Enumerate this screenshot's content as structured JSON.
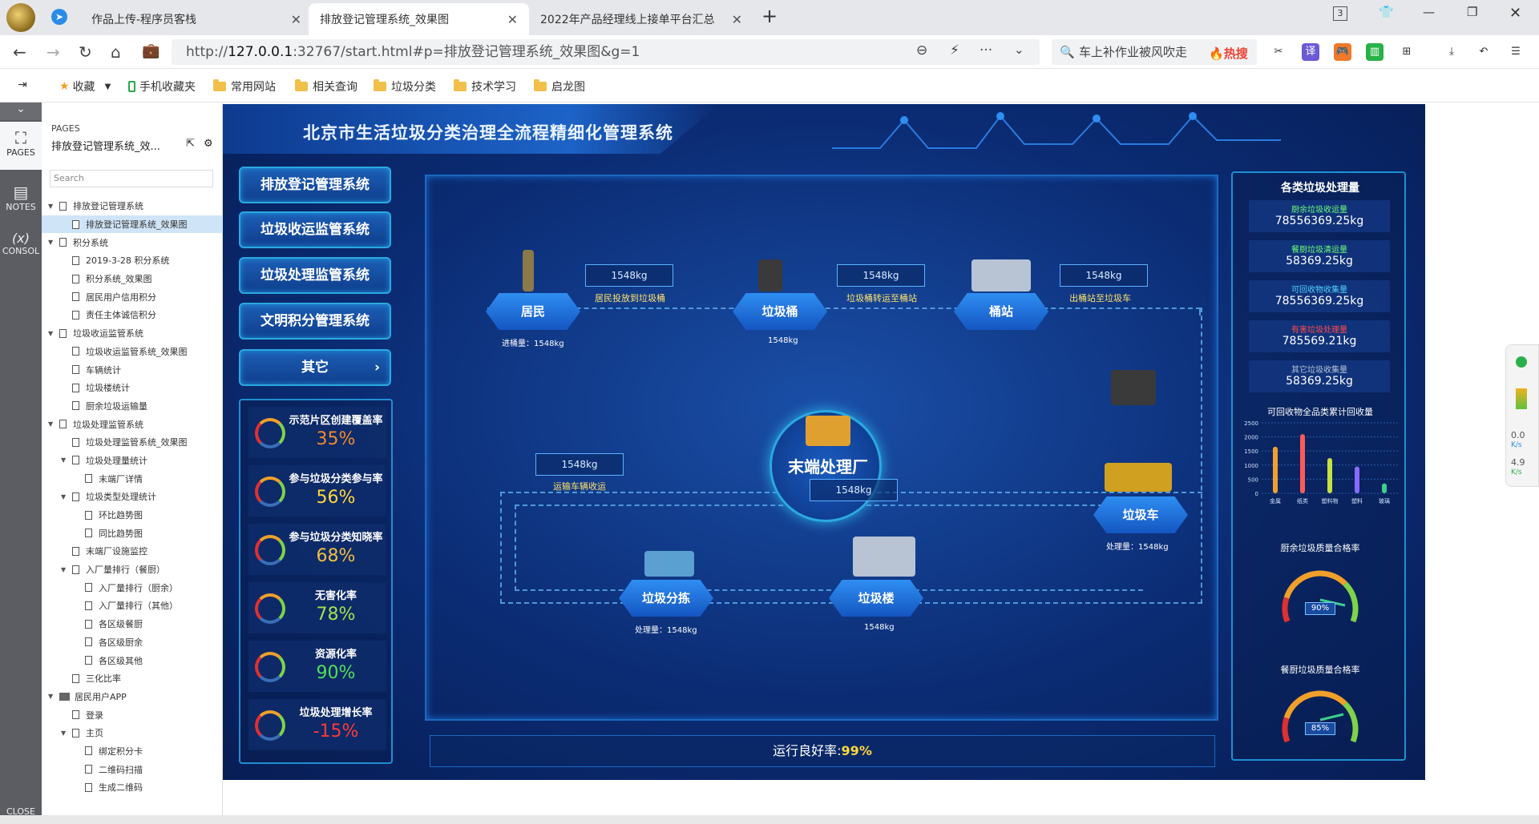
{
  "browser": {
    "tabs": [
      {
        "label": "作品上传-程序员客栈"
      },
      {
        "label": "排放登记管理系统_效果图"
      },
      {
        "label": "2022年产品经理线上接单平台汇总"
      }
    ],
    "tab_count": "3",
    "url_prefix": "http://",
    "url_host": "127.0.0.1",
    "url_rest": ":32767/start.html#p=排放登记管理系统_效果图&g=1",
    "search_text": "车上补作业被风吹走",
    "hot_label": "热搜"
  },
  "bookmarks": [
    "收藏",
    "手机收藏夹",
    "常用网站",
    "相关查询",
    "垃圾分类",
    "技术学习",
    "启龙图"
  ],
  "rail": {
    "pages": "PAGES",
    "notes": "NOTES",
    "console": "CONSOL",
    "close": "CLOSE"
  },
  "pages_panel": {
    "header": "PAGES",
    "current": "排放登记管理系统_效...",
    "search_placeholder": "Search",
    "tree": [
      {
        "label": "排放登记管理系统",
        "level": 0,
        "arrow": true
      },
      {
        "label": "排放登记管理系统_效果图",
        "level": 1,
        "selected": true
      },
      {
        "label": "积分系统",
        "level": 0,
        "arrow": true
      },
      {
        "label": "2019-3-28 积分系统",
        "level": 1
      },
      {
        "label": "积分系统_效果图",
        "level": 1
      },
      {
        "label": "居民用户信用积分",
        "level": 1
      },
      {
        "label": "责任主体诚信积分",
        "level": 1
      },
      {
        "label": "垃圾收运监管系统",
        "level": 0,
        "arrow": true
      },
      {
        "label": "垃圾收运监管系统_效果图",
        "level": 1
      },
      {
        "label": "车辆统计",
        "level": 1
      },
      {
        "label": "垃圾楼统计",
        "level": 1
      },
      {
        "label": "厨余垃圾运输量",
        "level": 1
      },
      {
        "label": "垃圾处理监管系统",
        "level": 0,
        "arrow": true
      },
      {
        "label": "垃圾处理监管系统_效果图",
        "level": 1
      },
      {
        "label": "垃圾处理量统计",
        "level": 1,
        "arrow": true
      },
      {
        "label": "末端厂详情",
        "level": 2
      },
      {
        "label": "垃圾类型处理统计",
        "level": 1,
        "arrow": true
      },
      {
        "label": "环比趋势图",
        "level": 2
      },
      {
        "label": "同比趋势图",
        "level": 2
      },
      {
        "label": "末端厂设施监控",
        "level": 1
      },
      {
        "label": "入厂量排行（餐厨）",
        "level": 1,
        "arrow": true
      },
      {
        "label": "入厂量排行（厨余）",
        "level": 2
      },
      {
        "label": "入厂量排行（其他）",
        "level": 2
      },
      {
        "label": "各区级餐厨",
        "level": 2
      },
      {
        "label": "各区级厨余",
        "level": 2
      },
      {
        "label": "各区级其他",
        "level": 2
      },
      {
        "label": "三化比率",
        "level": 1
      },
      {
        "label": "居民用户APP",
        "level": 0,
        "arrow": true,
        "folder": true
      },
      {
        "label": "登录",
        "level": 1
      },
      {
        "label": "主页",
        "level": 1,
        "arrow": true
      },
      {
        "label": "绑定积分卡",
        "level": 2
      },
      {
        "label": "二维码扫描",
        "level": 2
      },
      {
        "label": "生成二维码",
        "level": 2
      }
    ]
  },
  "dashboard": {
    "title": "北京市生活垃圾分类治理全流程精细化管理系统",
    "menu": [
      "排放登记管理系统",
      "垃圾收运监管系统",
      "垃圾处理监管系统",
      "文明积分管理系统",
      "其它"
    ],
    "metrics": [
      {
        "label": "示范片区创建覆盖率",
        "value": "35%",
        "color": "#f08a2a"
      },
      {
        "label": "参与垃圾分类参与率",
        "value": "56%",
        "color": "#ffd93b"
      },
      {
        "label": "参与垃圾分类知晓率",
        "value": "68%",
        "color": "#f0c040"
      },
      {
        "label": "无害化率",
        "value": "78%",
        "color": "#a6e04a"
      },
      {
        "label": "资源化率",
        "value": "90%",
        "color": "#4fe05a"
      },
      {
        "label": "垃圾处理增长率",
        "value": "-15%",
        "color": "#ff3a3a"
      }
    ],
    "flow": {
      "nodes": {
        "resident": "居民",
        "bin": "垃圾桶",
        "station": "桶站",
        "truck": "垃圾车",
        "sort": "垃圾分拣",
        "tower": "垃圾楼",
        "center": "末端处理厂"
      },
      "values": {
        "v1": "1548kg",
        "v2": "1548kg",
        "v3": "1548kg",
        "v4": "1548kg",
        "center": "1548kg"
      },
      "labels": {
        "l1": "居民投放到垃圾桶",
        "l2": "垃圾桶转运至桶站",
        "l3": "出桶站至垃圾车",
        "l4": "运输车辆收运"
      },
      "subs": {
        "resident": "进桶量：1548kg",
        "bin": "1548kg",
        "truck": "处理量：1548kg",
        "sort": "处理量：1548kg",
        "tower": "1548kg"
      }
    },
    "running": {
      "label": "运行良好率:",
      "value": "99%"
    },
    "right": {
      "title": "各类垃圾处理量",
      "stats": [
        {
          "label": "厨余垃圾收运量",
          "value": "78556369.25kg",
          "color": "#6bff7a"
        },
        {
          "label": "餐厨垃圾清运量",
          "value": "58369.25kg",
          "color": "#6bff7a"
        },
        {
          "label": "可回收物收集量",
          "value": "78556369.25kg",
          "color": "#4fd2ff"
        },
        {
          "label": "有害垃圾处理量",
          "value": "785569.21kg",
          "color": "#ff4a4a"
        },
        {
          "label": "其它垃圾收集量",
          "value": "58369.25kg",
          "color": "#b7c4d8"
        }
      ],
      "bar_title": "可回收物全品类累计回收量",
      "gauge1_title": "厨余垃圾质量合格率",
      "gauge1_value": "90%",
      "gauge2_title": "餐厨垃圾质量合格率",
      "gauge2_value": "85%"
    }
  },
  "chart_data": {
    "type": "bar",
    "title": "可回收物全品类累计回收量",
    "categories": [
      "金属",
      "纸类",
      "塑料物",
      "塑料",
      "玻璃"
    ],
    "values": [
      1650,
      2100,
      1250,
      950,
      350
    ],
    "ylim": [
      0,
      2500
    ],
    "yticks": [
      0,
      500,
      1000,
      1500,
      2000,
      2500
    ],
    "colors": [
      "#f0a030",
      "#ff5a5a",
      "#c8e040",
      "#8a6aff",
      "#3ad08a"
    ]
  },
  "sidewidget": {
    "v1": "0.0",
    "u1": "K/s",
    "v2": "4.9",
    "u2": "K/s"
  }
}
